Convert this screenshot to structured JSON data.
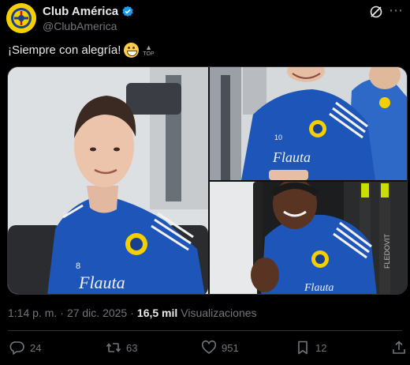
{
  "header": {
    "display_name": "Club América",
    "handle": "@ClubAmerica"
  },
  "post": {
    "text": "¡Siempre con alegría!",
    "emoji_badge": "TOP"
  },
  "media": {
    "photos": [
      {
        "description": "player-portrait-left"
      },
      {
        "description": "player-top-right"
      },
      {
        "description": "player-bottom-right"
      }
    ],
    "jersey_text": [
      "Flauta",
      "8",
      "10",
      "FLEDOVIT"
    ]
  },
  "meta": {
    "time": "1:14 p. m.",
    "separator": "·",
    "date": "27 dic. 2025",
    "separator2": "·",
    "views_count": "16,5 mil",
    "views_label": "Visualizaciones"
  },
  "actions": {
    "replies": "24",
    "reposts": "63",
    "likes": "951",
    "bookmarks": "12"
  },
  "colors": {
    "background": "#000000",
    "text": "#e7e9ea",
    "muted": "#71767b",
    "verified": "#1d9bf0",
    "america_yellow": "#f5d000",
    "america_blue": "#1a3f8c"
  },
  "icons": [
    "club-america-crest-icon",
    "verified-badge-icon",
    "grok-icon",
    "more-icon",
    "reply-icon",
    "repost-icon",
    "like-icon",
    "bookmark-icon",
    "share-icon"
  ]
}
